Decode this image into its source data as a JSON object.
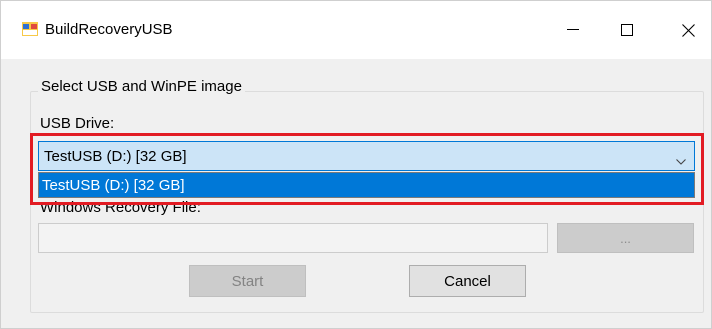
{
  "window": {
    "title": "BuildRecoveryUSB",
    "icon": "app-window-icon",
    "controls": {
      "minimize": "minimize-icon",
      "maximize": "maximize-icon",
      "close": "close-icon"
    }
  },
  "groupbox": {
    "legend": "Select USB and WinPE image"
  },
  "usb": {
    "label": "USB Drive:",
    "selected": "TestUSB (D:) [32 GB]",
    "options": [
      "TestUSB (D:) [32 GB]"
    ]
  },
  "recovery_file": {
    "label": "Windows Recovery File:",
    "value": "",
    "browse_label": "..."
  },
  "buttons": {
    "start": "Start",
    "cancel": "Cancel"
  },
  "colors": {
    "selection": "#0078d7",
    "combo_focus_bg": "#cce4f7",
    "annotation_border": "#e21b23"
  }
}
